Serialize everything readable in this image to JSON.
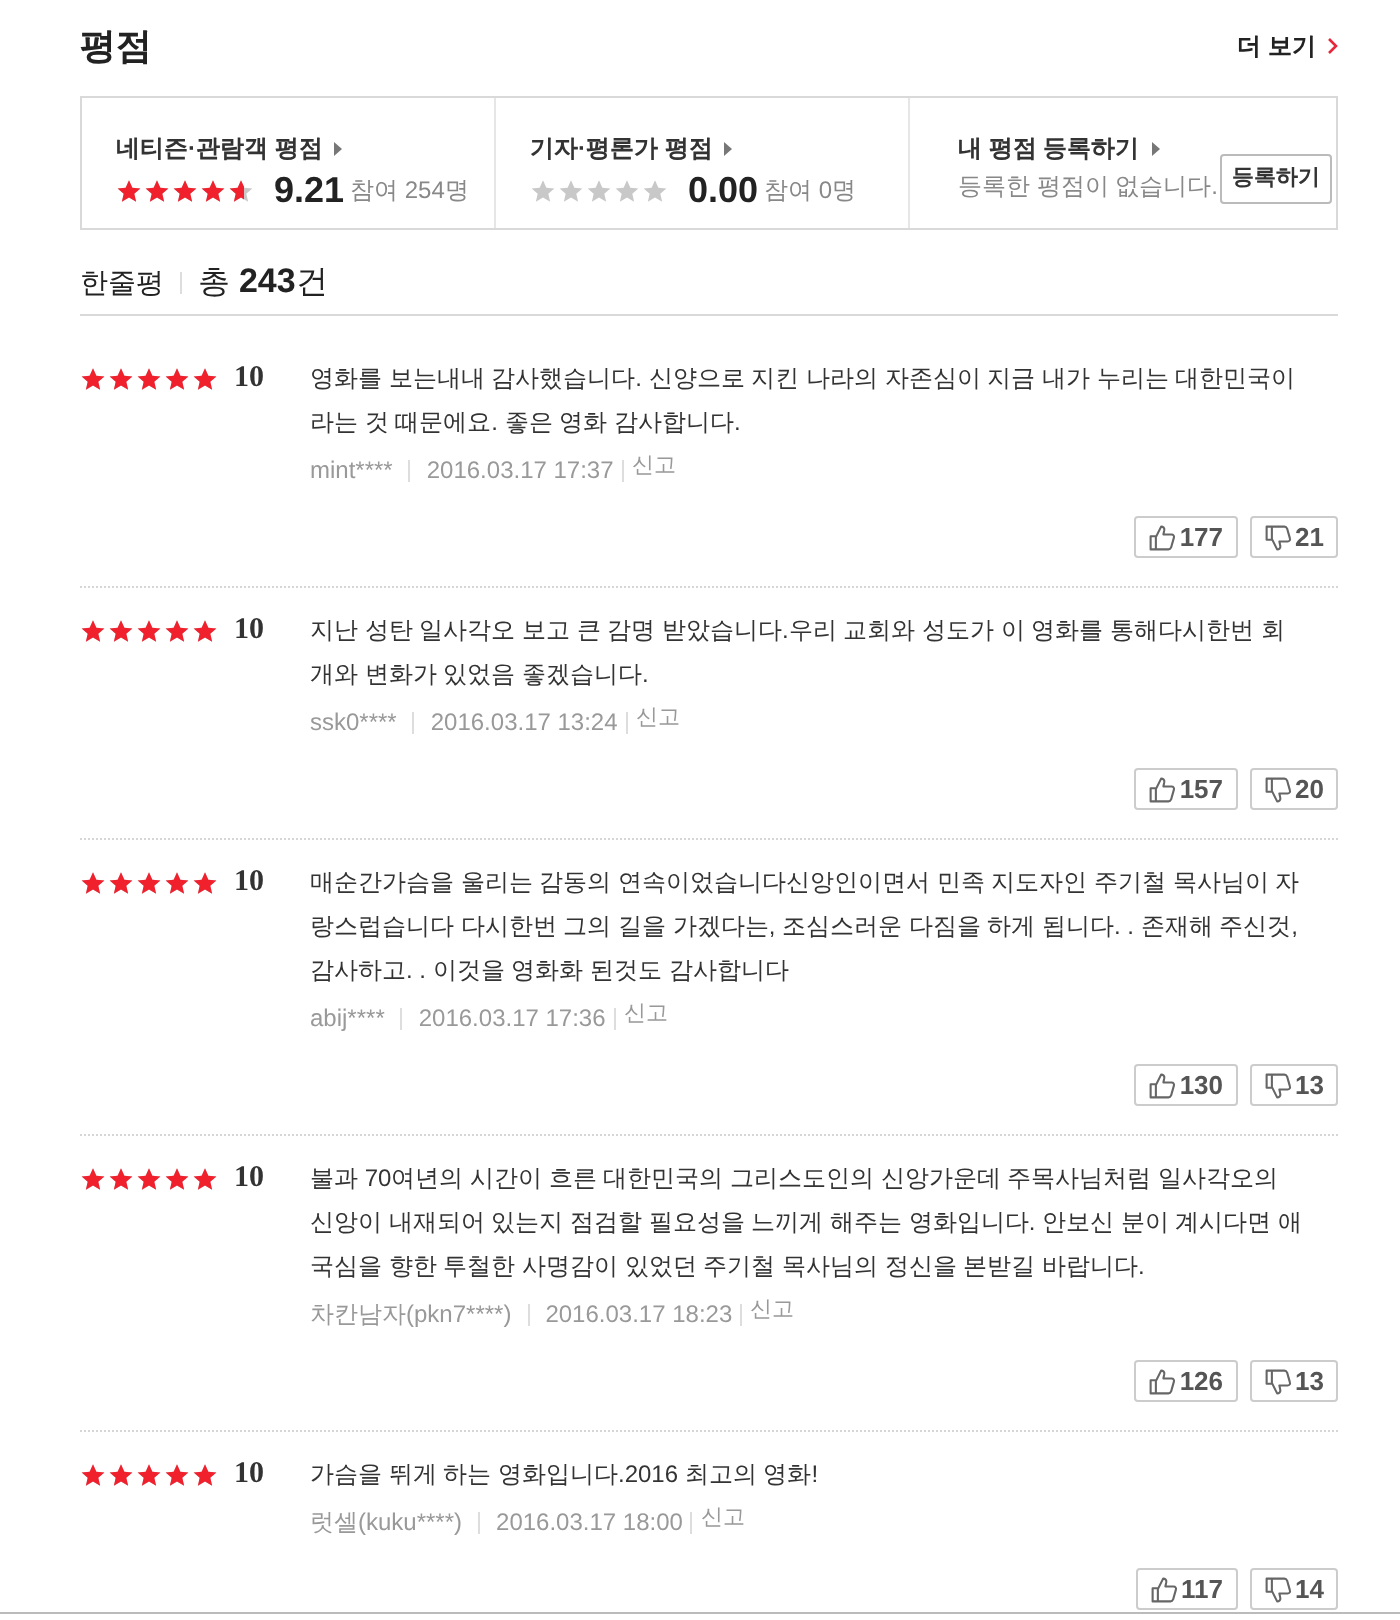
{
  "header": {
    "title": "평점",
    "more_link": "더 보기"
  },
  "summary": [
    {
      "kind": "rating",
      "label": "네티즌·관람객 평점",
      "stars": 4.6,
      "score": "9.21",
      "participants": "참여 254명"
    },
    {
      "kind": "rating",
      "label": "기자·평론가 평점",
      "stars": 0,
      "score": "0.00",
      "participants": "참여 0명"
    },
    {
      "kind": "register",
      "label": "내 평점 등록하기",
      "message": "등록한 평점이 없습니다.",
      "button": "등록하기"
    }
  ],
  "reviews_header": {
    "title": "한줄평",
    "total": "총 **243**건"
  },
  "reviews": [
    {
      "stars": 5,
      "score": "10",
      "text": "영화를 보는내내 감사했습니다. 신양으로 지킨 나라의 자존심이 지금 내가 누리는 대한민국이라는 것 때문에요. 좋은 영화 감사합니다.",
      "user": "mint****",
      "date": "2016.03.17 17:37",
      "report": "신고",
      "likes": "177",
      "dislikes": "21"
    },
    {
      "stars": 5,
      "score": "10",
      "text": "지난 성탄 일사각오 보고 큰 감명 받았습니다.우리 교회와 성도가 이 영화를 통해다시한번 회개와 변화가 있었음 좋겠습니다.",
      "user": "ssk0****",
      "date": "2016.03.17 13:24",
      "report": "신고",
      "likes": "157",
      "dislikes": "20"
    },
    {
      "stars": 5,
      "score": "10",
      "text": "매순간가슴을 울리는 감동의 연속이었습니다신앙인이면서 민족 지도자인 주기철 목사님이 자랑스럽습니다 다시한번 그의 길을 가겠다는, 조심스러운 다짐을 하게 됩니다. . 존재해 주신것, 감사하고. . 이것을 영화화 된것도 감사합니다",
      "user": "abij****",
      "date": "2016.03.17 17:36",
      "report": "신고",
      "likes": "130",
      "dislikes": "13"
    },
    {
      "stars": 5,
      "score": "10",
      "text": "불과 70여년의 시간이 흐른 대한민국의 그리스도인의 신앙가운데 주목사님처럼 일사각오의 신앙이 내재되어 있는지 점검할 필요성을 느끼게 해주는 영화입니다. 안보신 분이 계시다면 애국심을 향한 투철한 사명감이 있었던 주기철 목사님의 정신을 본받길 바랍니다.",
      "user": "차칸남자(pkn7****)",
      "date": "2016.03.17 18:23",
      "report": "신고",
      "likes": "126",
      "dislikes": "13"
    },
    {
      "stars": 5,
      "score": "10",
      "text": "가슴을 뛰게 하는 영화입니다.2016 최고의 영화!",
      "user": "럿셀(kuku****)",
      "date": "2016.03.17 18:00",
      "report": "신고",
      "likes": "117",
      "dislikes": "14"
    }
  ]
}
